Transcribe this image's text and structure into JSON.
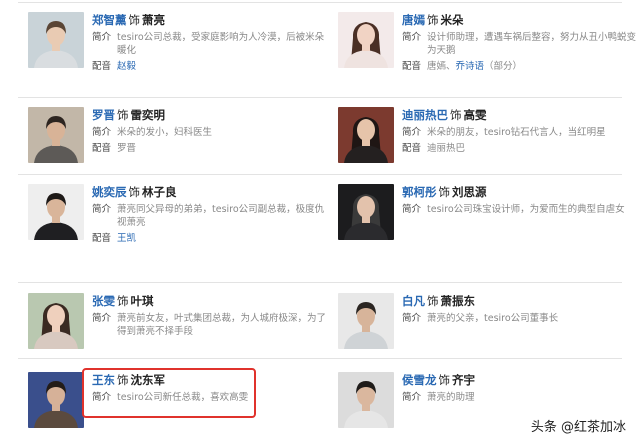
{
  "labels": {
    "sep": "饰",
    "intro": "简介",
    "voice": "配音"
  },
  "cards": [
    {
      "actor": "郑智薰",
      "role": "萧亮",
      "intro": "tesiro公司总裁，受家庭影响为人冷漠，后被米朵暖化",
      "voice": [
        "赵毅"
      ],
      "voice_links": [
        0
      ],
      "photo": "portrait-man-light-shirt"
    },
    {
      "actor": "唐嫣",
      "role": "米朵",
      "intro": "设计师助理，遭遇车祸后整容，努力从丑小鸭蜕变为天鹅",
      "voice": [
        "唐嫣、",
        "乔诗语",
        "（部分）"
      ],
      "voice_links": [
        1
      ],
      "photo": "portrait-woman-long-hair"
    },
    {
      "actor": "罗晋",
      "role": "雷奕明",
      "intro": "米朵的发小，妇科医生",
      "voice": [
        "罗晋"
      ],
      "voice_links": [],
      "photo": "portrait-man-suit"
    },
    {
      "actor": "迪丽热巴",
      "role": "高雯",
      "intro": "米朵的朋友，tesiro钻石代言人，当红明星",
      "voice": [
        "迪丽热巴"
      ],
      "voice_links": [],
      "photo": "portrait-woman-dark-dress"
    },
    {
      "actor": "姚奕辰",
      "role": "林子良",
      "intro": "萧亮同父异母的弟弟，tesiro公司副总裁，极度仇视萧亮",
      "voice": [
        "王凯"
      ],
      "voice_links": [
        0
      ],
      "photo": "portrait-man-tuxedo"
    },
    {
      "actor": "郭柯彤",
      "role": "刘思源",
      "intro": "tesiro公司珠宝设计师，为爱而生的典型自虐女",
      "voice": [],
      "voice_links": [],
      "photo": "portrait-woman-dark-bg"
    },
    {
      "actor": "张雯",
      "role": "叶琪",
      "intro": "萧亮前女友，叶式集团总裁，为人城府极深，为了得到萧亮不择手段",
      "voice": [],
      "voice_links": [],
      "photo": "portrait-woman-smiling"
    },
    {
      "actor": "白凡",
      "role": "萧振东",
      "intro": "萧亮的父亲，tesiro公司董事长",
      "voice": [],
      "voice_links": [],
      "photo": "portrait-older-man"
    },
    {
      "actor": "王东",
      "role": "沈东军",
      "intro": "tesiro公司新任总裁，喜欢高雯",
      "voice": [],
      "voice_links": [],
      "photo": "portrait-man-blue-lights"
    },
    {
      "actor": "侯雪龙",
      "role": "齐宇",
      "intro": "萧亮的助理",
      "voice": [],
      "voice_links": [],
      "photo": "portrait-man-short-hair"
    }
  ],
  "watermark": "头条 @红茶加冰"
}
